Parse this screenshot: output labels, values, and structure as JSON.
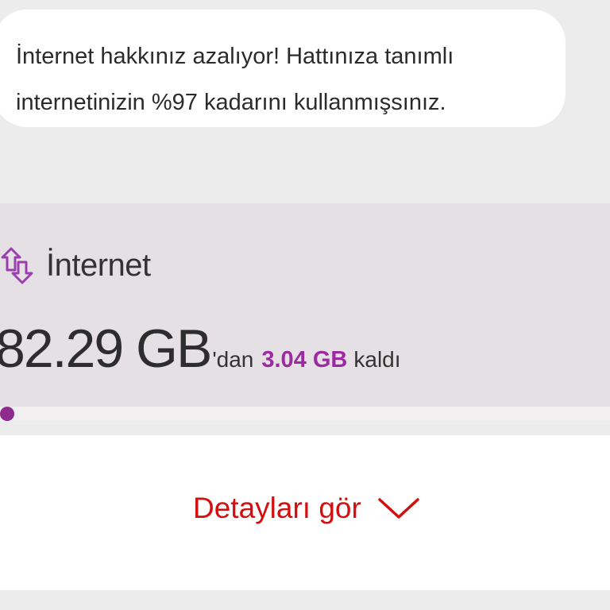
{
  "notification": {
    "line1": "İnternet hakkınız azalıyor! Hattınıza tanımlı",
    "line2": "internetinizin %97 kadarını kullanmışsınız."
  },
  "internet_card": {
    "icon": "data-transfer-arrows-icon",
    "title": "İnternet",
    "total": "82.29 GB",
    "total_suffix": "'dan",
    "remaining": "3.04 GB",
    "remaining_suffix": "kaldı",
    "remaining_fraction": 0.037
  },
  "details": {
    "label": "Detayları gör",
    "icon": "chevron-down-icon"
  },
  "colors": {
    "accent_purple": "#9c2aa0",
    "link_red": "#d10f0f",
    "card_background": "#e5e0e3"
  }
}
